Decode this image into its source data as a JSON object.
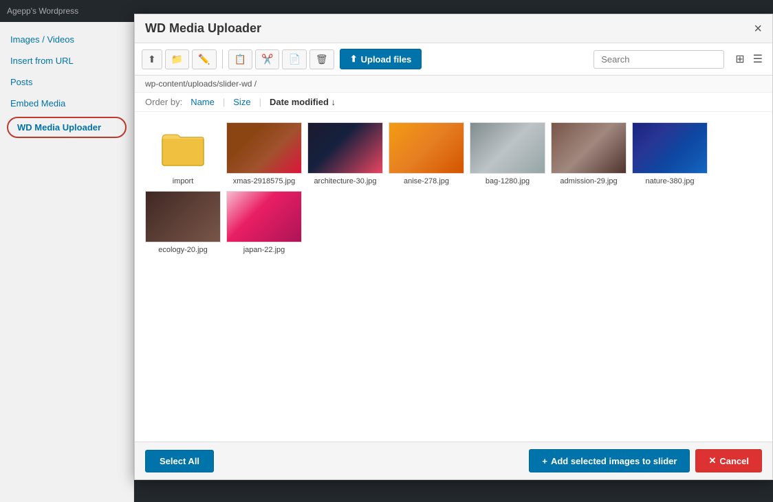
{
  "adminBar": {
    "siteName": "Agepp's Wordpress"
  },
  "sidebar": {
    "items": [
      {
        "id": "images-videos",
        "label": "Images / Videos"
      },
      {
        "id": "insert-from-url",
        "label": "Insert from URL"
      },
      {
        "id": "posts",
        "label": "Posts"
      },
      {
        "id": "embed-media",
        "label": "Embed Media"
      },
      {
        "id": "wd-media-uploader",
        "label": "WD Media Uploader",
        "active": true
      }
    ]
  },
  "modal": {
    "title": "WD Media Uploader",
    "closeLabel": "×",
    "toolbar": {
      "uploadLabel": "Upload files",
      "searchPlaceholder": "Search"
    },
    "pathBar": "wp-content/uploads/slider-wd /",
    "orderBar": {
      "label": "Order by:",
      "options": [
        "Name",
        "Size",
        "Date modified ↓"
      ]
    },
    "files": [
      {
        "id": "import",
        "type": "folder",
        "name": "import"
      },
      {
        "id": "xmas",
        "type": "image",
        "imgClass": "img-xmas",
        "name": "xmas-2918575.jpg"
      },
      {
        "id": "architecture",
        "type": "image",
        "imgClass": "img-arch",
        "name": "architecture-30.jpg"
      },
      {
        "id": "anise",
        "type": "image",
        "imgClass": "img-anise",
        "name": "anise-278.jpg"
      },
      {
        "id": "bag",
        "type": "image",
        "imgClass": "img-bag",
        "name": "bag-1280.jpg"
      },
      {
        "id": "admission",
        "type": "image",
        "imgClass": "img-admission",
        "name": "admission-29.jpg"
      },
      {
        "id": "nature",
        "type": "image",
        "imgClass": "img-nature",
        "name": "nature-380.jpg"
      },
      {
        "id": "ecology",
        "type": "image",
        "imgClass": "img-ecology",
        "name": "ecology-20.jpg"
      },
      {
        "id": "japan",
        "type": "image",
        "imgClass": "img-japan",
        "name": "japan-22.jpg"
      }
    ],
    "footer": {
      "selectAllLabel": "Select All",
      "addToSliderLabel": "Add selected images to slider",
      "cancelLabel": "Cancel"
    }
  }
}
